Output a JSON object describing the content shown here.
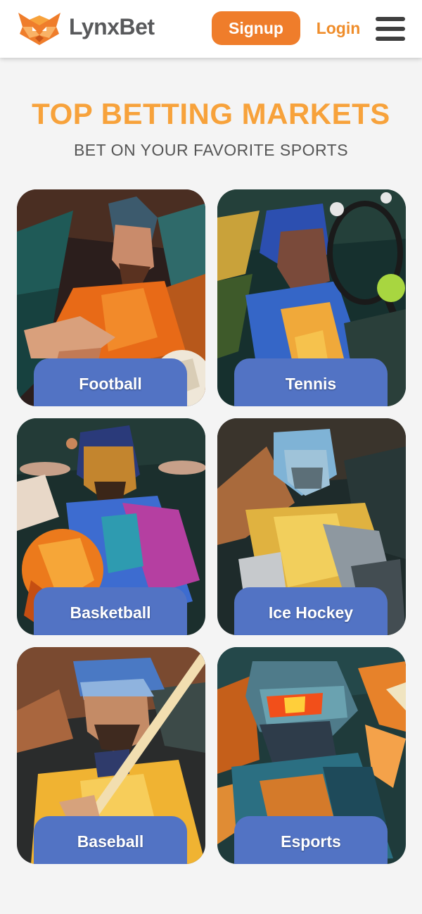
{
  "header": {
    "brand": "LynxBet",
    "signup_label": "Signup",
    "login_label": "Login",
    "logo_icon": "lynx-logo-icon",
    "menu_icon": "hamburger-menu-icon"
  },
  "section": {
    "title": "TOP BETTING MARKETS",
    "subtitle": "BET ON YOUR FAVORITE SPORTS"
  },
  "markets": [
    {
      "label": "Football"
    },
    {
      "label": "Tennis"
    },
    {
      "label": "Basketball"
    },
    {
      "label": "Ice Hockey"
    },
    {
      "label": "Baseball"
    },
    {
      "label": "Esports"
    }
  ],
  "colors": {
    "accent": "#ef7d2b",
    "title": "#f7a23b",
    "card_label_bg": "#5273c4"
  }
}
